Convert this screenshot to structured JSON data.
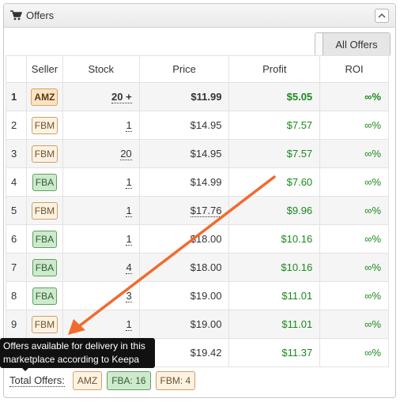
{
  "panel": {
    "title": "Offers",
    "icon": "cart-icon",
    "collapse_icon": "chevron-up-icon"
  },
  "toolbar": {
    "all_offers_label": "All Offers"
  },
  "table": {
    "headers": [
      "",
      "Seller",
      "Stock",
      "Price",
      "Profit",
      "ROI"
    ],
    "rows": [
      {
        "num": "1",
        "seller": "AMZ",
        "stock": "20 +",
        "price": "$11.99",
        "profit": "$5.05",
        "roi": "∞%"
      },
      {
        "num": "2",
        "seller": "FBM",
        "stock": "1",
        "price": "$14.95",
        "profit": "$7.57",
        "roi": "∞%"
      },
      {
        "num": "3",
        "seller": "FBM",
        "stock": "20",
        "price": "$14.95",
        "profit": "$7.57",
        "roi": "∞%"
      },
      {
        "num": "4",
        "seller": "FBA",
        "stock": "1",
        "price": "$14.99",
        "profit": "$7.60",
        "roi": "∞%"
      },
      {
        "num": "5",
        "seller": "FBM",
        "stock": "1",
        "price": "$17.76",
        "profit": "$9.96",
        "roi": "∞%"
      },
      {
        "num": "6",
        "seller": "FBA",
        "stock": "1",
        "price": "$18.00",
        "profit": "$10.16",
        "roi": "∞%"
      },
      {
        "num": "7",
        "seller": "FBA",
        "stock": "4",
        "price": "$18.00",
        "profit": "$10.16",
        "roi": "∞%"
      },
      {
        "num": "8",
        "seller": "FBA",
        "stock": "3",
        "price": "$19.00",
        "profit": "$11.01",
        "roi": "∞%"
      },
      {
        "num": "9",
        "seller": "FBM",
        "stock": "1",
        "price": "$19.00",
        "profit": "$11.01",
        "roi": "∞%"
      },
      {
        "num": "",
        "seller": "",
        "stock": "",
        "price": "$19.42",
        "profit": "$11.37",
        "roi": "∞%"
      }
    ]
  },
  "footer": {
    "label": "Total Offers:",
    "badges": {
      "amz": "AMZ",
      "fba": "FBA: 16",
      "fbm": "FBM: 4"
    }
  },
  "tooltip": {
    "line1": "Offers available for delivery in this",
    "line2": "marketplace according to Keepa"
  },
  "colors": {
    "profit_green": "#1a8a1a",
    "annotation_arrow": "#f26a2e",
    "badge_amz": "#fbe3c3",
    "badge_fba": "#cfe9cf",
    "badge_fbm": "#fdf2e1"
  }
}
